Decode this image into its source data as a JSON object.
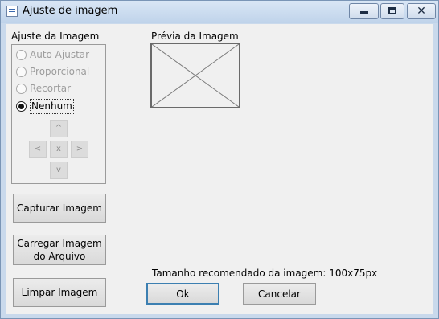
{
  "window": {
    "title": "Ajuste de imagem"
  },
  "adjust_group": {
    "label": "Ajuste da Imagem",
    "options": [
      {
        "label": "Auto Ajustar",
        "enabled": false,
        "checked": false
      },
      {
        "label": "Proporcional",
        "enabled": false,
        "checked": false
      },
      {
        "label": "Recortar",
        "enabled": false,
        "checked": false
      },
      {
        "label": "Nenhum",
        "enabled": true,
        "checked": true
      }
    ],
    "arrows": {
      "up": "^",
      "left": "<",
      "center": "x",
      "right": ">",
      "down": "v"
    }
  },
  "buttons": {
    "capture": "Capturar Imagem",
    "load_line1": "Carregar Imagem",
    "load_line2": "do Arquivo",
    "clear": "Limpar Imagem",
    "ok": "Ok",
    "cancel": "Cancelar"
  },
  "preview": {
    "label": "Prévia da Imagem",
    "recommended_size": "Tamanho recomendado da imagem: 100x75px"
  }
}
